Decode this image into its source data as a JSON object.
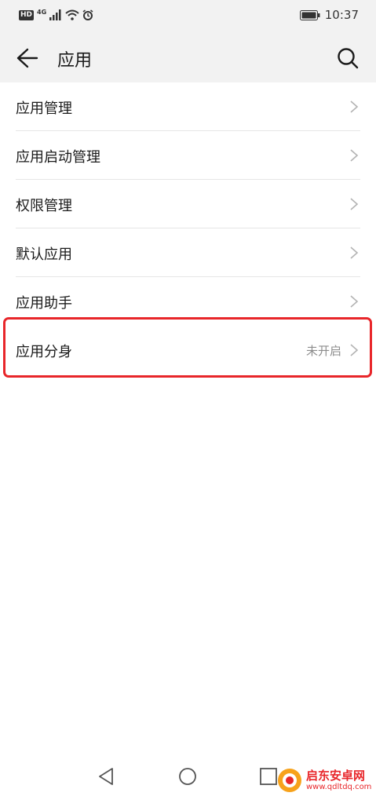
{
  "status_bar": {
    "hd_badge": "HD",
    "network": "4G",
    "time": "10:37"
  },
  "app_bar": {
    "title": "应用"
  },
  "menu": {
    "items": [
      {
        "label": "应用管理",
        "status": ""
      },
      {
        "label": "应用启动管理",
        "status": ""
      },
      {
        "label": "权限管理",
        "status": ""
      },
      {
        "label": "默认应用",
        "status": ""
      },
      {
        "label": "应用助手",
        "status": ""
      },
      {
        "label": "应用分身",
        "status": "未开启"
      }
    ]
  },
  "highlight_color": "#e8262a",
  "watermark": {
    "title": "启东安卓网",
    "url": "www.qdltdq.com"
  }
}
